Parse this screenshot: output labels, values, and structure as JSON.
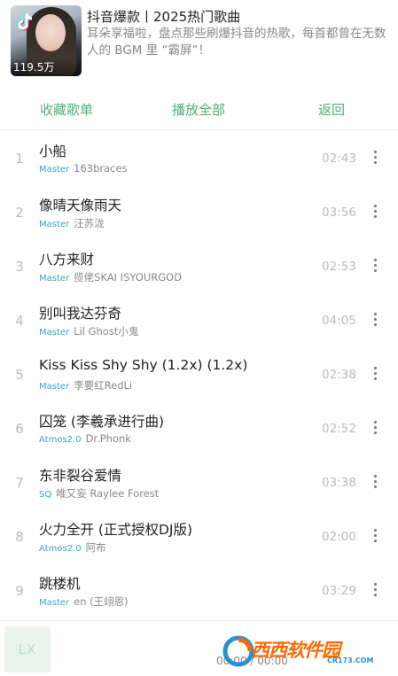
{
  "playlist": {
    "title": "抖音爆款丨2025热门歌曲",
    "description": "耳朵享福啦，盘点那些刷爆抖音的热歌，每首都曾在无数人的 BGM 里 “霸屏”！",
    "play_count": "119.5万",
    "cover_icon": "tiktok-logo"
  },
  "actions": {
    "collect_label": "收藏歌单",
    "play_all_label": "播放全部",
    "back_label": "返回"
  },
  "songs": [
    {
      "index": "1",
      "name": "小船",
      "quality": "Master",
      "artist": "163braces",
      "duration": "02:43"
    },
    {
      "index": "2",
      "name": "像晴天像雨天",
      "quality": "Master",
      "artist": "汪苏泷",
      "duration": "03:56"
    },
    {
      "index": "3",
      "name": "八方来财",
      "quality": "Master",
      "artist": "揽佬SKAI ISYOURGOD",
      "duration": "02:53"
    },
    {
      "index": "4",
      "name": "别叫我达芬奇",
      "quality": "Master",
      "artist": "Lil Ghost小鬼",
      "duration": "04:05"
    },
    {
      "index": "5",
      "name": "Kiss Kiss Shy Shy (1.2x) (1.2x)",
      "quality": "Master",
      "artist": "李要红RedLi",
      "duration": "02:38"
    },
    {
      "index": "6",
      "name": "囚笼 (李羲承进行曲)",
      "quality": "Atmos2.0",
      "artist": "Dr.Phonk",
      "duration": "02:52"
    },
    {
      "index": "7",
      "name": "东非裂谷爱情",
      "quality": "SQ",
      "artist": "唯又妄 Raylee Forest",
      "duration": "03:38"
    },
    {
      "index": "8",
      "name": "火力全开 (正式授权DJ版)",
      "quality": "Atmos2.0",
      "artist": "阿布",
      "duration": "02:00"
    },
    {
      "index": "9",
      "name": "跳楼机",
      "quality": "Master",
      "artist": "en (王翊恩)",
      "duration": "03:29"
    }
  ],
  "player": {
    "cover_text": "LX",
    "time": "00:00 / 00:00"
  },
  "watermark": {
    "text": "西西软件园",
    "domain": "CR173.COM"
  },
  "colors": {
    "accent": "#4caf7d",
    "quality": "#3aa3c9",
    "muted": "#888888"
  }
}
